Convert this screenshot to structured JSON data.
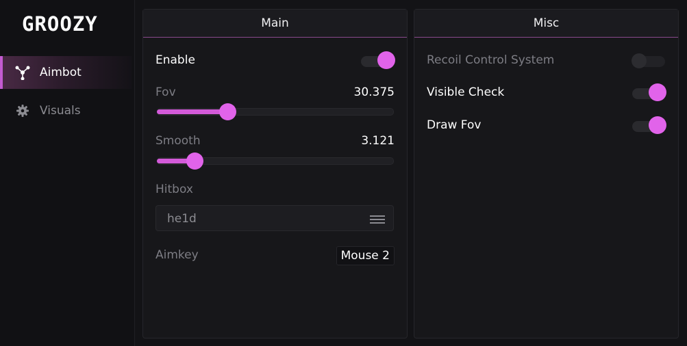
{
  "app": {
    "logo": "GROOZY"
  },
  "sidebar": {
    "items": [
      {
        "label": "Aimbot",
        "icon": "crosshair-nodes-icon",
        "active": true
      },
      {
        "label": "Visuals",
        "icon": "gear-icon",
        "active": false
      }
    ]
  },
  "main_panel": {
    "title": "Main",
    "enable": {
      "label": "Enable",
      "value": true
    },
    "fov": {
      "label": "Fov",
      "value": "30.375",
      "fraction": 0.3
    },
    "smooth": {
      "label": "Smooth",
      "value": "3.121",
      "fraction": 0.16
    },
    "hitbox": {
      "label": "Hitbox",
      "selected": "he1d",
      "icon": "hamburger-menu-icon"
    },
    "aimkey": {
      "label": "Aimkey",
      "value": "Mouse 2"
    }
  },
  "misc_panel": {
    "title": "Misc",
    "recoil": {
      "label": "Recoil Control System",
      "value": false
    },
    "visible_check": {
      "label": "Visible Check",
      "value": true
    },
    "draw_fov": {
      "label": "Draw Fov",
      "value": true
    }
  },
  "colors": {
    "accent": "#e163ea",
    "background": "#131316",
    "panel": "#17171a"
  }
}
